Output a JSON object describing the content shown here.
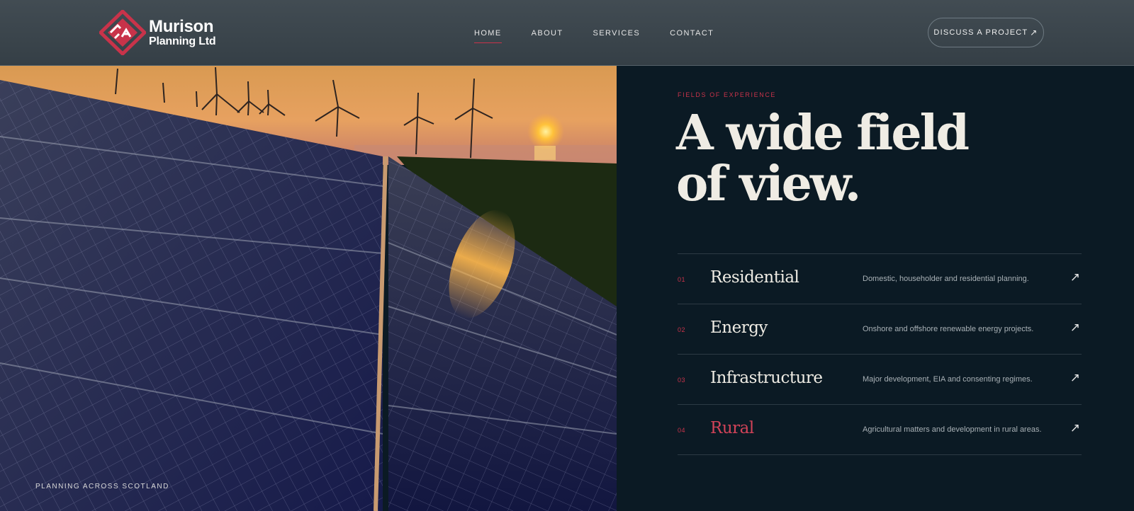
{
  "brand": {
    "name_line1": "Murison",
    "name_line2": "Planning Ltd",
    "accent_color": "#c8334a"
  },
  "nav": {
    "items": [
      {
        "label": "HOME",
        "active": true
      },
      {
        "label": "ABOUT",
        "active": false
      },
      {
        "label": "SERVICES",
        "active": false
      },
      {
        "label": "CONTACT",
        "active": false
      }
    ]
  },
  "cta": {
    "label": "DISCUSS A PROJECT",
    "icon": "arrow-up-right-icon"
  },
  "hero": {
    "tagline": "PLANNING ACROSS SCOTLAND",
    "image": "solar-panels-and-wind-turbines-at-sunset"
  },
  "section": {
    "eyebrow": "FIELDS OF EXPERIENCE",
    "headline_line1": "A wide field",
    "headline_line2": "of view."
  },
  "fields": [
    {
      "num": "01",
      "title": "Residential",
      "desc": "Domestic, householder and residential planning.",
      "highlight": false
    },
    {
      "num": "02",
      "title": "Energy",
      "desc": "Onshore and offshore renewable energy projects.",
      "highlight": false
    },
    {
      "num": "03",
      "title": "Infrastructure",
      "desc": "Major development, EIA and consenting regimes.",
      "highlight": false
    },
    {
      "num": "04",
      "title": "Rural",
      "desc": "Agricultural matters and development in rural areas.",
      "highlight": true
    }
  ],
  "colors": {
    "panel_bg": "#0b1a24",
    "header_bg": "#3b454c",
    "divider": "#2c3a44"
  }
}
